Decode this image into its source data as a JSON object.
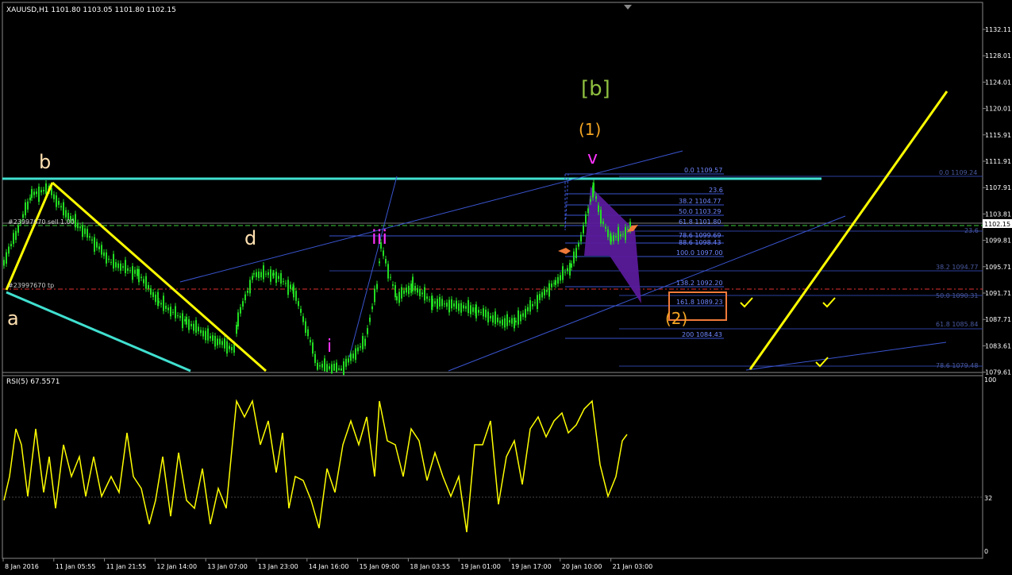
{
  "window": {
    "symbol_header": "XAUUSD,H1  1101.80 1103.05 1101.80 1102.15",
    "position_label": "#23997670 sell 1.00",
    "order_label": "#23997670 tp"
  },
  "price_axis": {
    "ticks": [
      "1132.11",
      "1128.01",
      "1124.01",
      "1120.01",
      "1115.91",
      "1111.91",
      "1107.91",
      "1103.81",
      "1099.81",
      "1095.71",
      "1091.71",
      "1087.71",
      "1083.61",
      "1079.61"
    ],
    "current_price": "1102.15"
  },
  "time_axis": {
    "ticks": [
      "8 Jan 2016",
      "11 Jan 05:55",
      "11 Jan 21:55",
      "12 Jan 14:00",
      "13 Jan 07:00",
      "13 Jan 23:00",
      "14 Jan 16:00",
      "15 Jan 09:00",
      "18 Jan 03:55",
      "19 Jan 01:00",
      "19 Jan 17:00",
      "20 Jan 10:00",
      "21 Jan 03:00"
    ]
  },
  "wave_labels": {
    "b_big": "[b]",
    "one": "(1)",
    "two": "(2)",
    "v": "v",
    "iii": "iii",
    "i": "i",
    "d": "d",
    "b": "b",
    "a": "a"
  },
  "fib_inner": [
    {
      "label": "0.0  1109.57"
    },
    {
      "label": "23.6"
    },
    {
      "label": "38.2  1104.77"
    },
    {
      "label": "50.0  1103.29"
    },
    {
      "label": "61.8  1101.80"
    },
    {
      "label": "78.6  1099.69"
    },
    {
      "label": "88.6  1098.43"
    },
    {
      "label": "100.0  1097.00"
    },
    {
      "label": "138.2  1092.20"
    },
    {
      "label": "161.8  1089.23"
    },
    {
      "label": "200  1084.43"
    }
  ],
  "fib_outer": [
    {
      "label": "0.0  1109.24"
    },
    {
      "label": "23.6"
    },
    {
      "label": "38.2  1094.77"
    },
    {
      "label": "50.0  1090.31"
    },
    {
      "label": "61.8  1085.84"
    },
    {
      "label": "78.6  1079.48"
    }
  ],
  "rsi": {
    "header": "RSI(5) 67.5571",
    "levels": [
      "100",
      "32",
      "0"
    ]
  },
  "colors": {
    "background": "#000000",
    "candle": "#22dd22",
    "cyan_line": "#40e0d0",
    "yellow_line": "#ffff00",
    "fib_line": "#3a55d0",
    "magenta": "#ff33ff",
    "orange": "#f5a623",
    "green_label": "#8fbf3f",
    "purple_zone": "#6a1fa0"
  }
}
